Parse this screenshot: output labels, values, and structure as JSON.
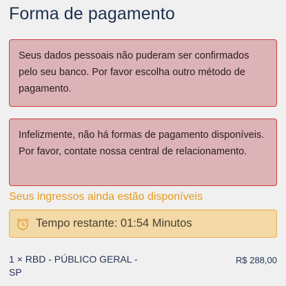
{
  "page": {
    "title": "Forma de pagamento"
  },
  "alerts": [
    {
      "text": "Seus dados pessoais não puderam ser confirmados pelo seu banco. Por favor escolha outro método de pagamento."
    },
    {
      "text": "Infelizmente, não há formas de pagamento disponíveis. Por favor, contate nossa central de relacionamento."
    }
  ],
  "availability": {
    "text": "Seus ingressos ainda estão disponíveis"
  },
  "timer": {
    "icon": "alarm-clock-icon",
    "label": "Tempo restante:",
    "value": "01:54",
    "unit": "Minutos"
  },
  "order": {
    "description": "1 × RBD - PÚBLICO GERAL - SP",
    "price": "R$ 288,00"
  },
  "colors": {
    "alert_background": "#dcb3b6",
    "alert_border": "#cf3b40",
    "warning_text": "#e39a1c",
    "timer_background": "#f2d9a5",
    "timer_border": "#e7b24a"
  }
}
